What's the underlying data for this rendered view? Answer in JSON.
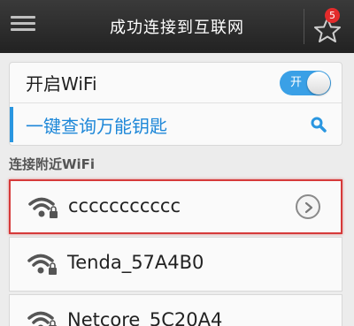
{
  "header": {
    "title": "成功连接到互联网",
    "badge": "5",
    "menu_icon": "menu-icon",
    "star_icon": "star-icon"
  },
  "wifi_toggle_row": {
    "label": "开启WiFi",
    "toggle_text": "开",
    "enabled": true
  },
  "key_row": {
    "label": "一键查询万能钥匙",
    "icon": "search-icon"
  },
  "section": {
    "title": "连接附近WiFi"
  },
  "networks": [
    {
      "ssid": "ccccccccccc",
      "locked": true,
      "highlighted": true,
      "action_icon": "chevron-right-icon"
    },
    {
      "ssid": "Tenda_57A4B0",
      "locked": true
    },
    {
      "ssid": "Netcore_5C20A4",
      "locked": true
    }
  ],
  "colors": {
    "accent": "#2a96e0",
    "highlight_border": "#d63a3a",
    "header_bg": "#2d2d2d"
  }
}
